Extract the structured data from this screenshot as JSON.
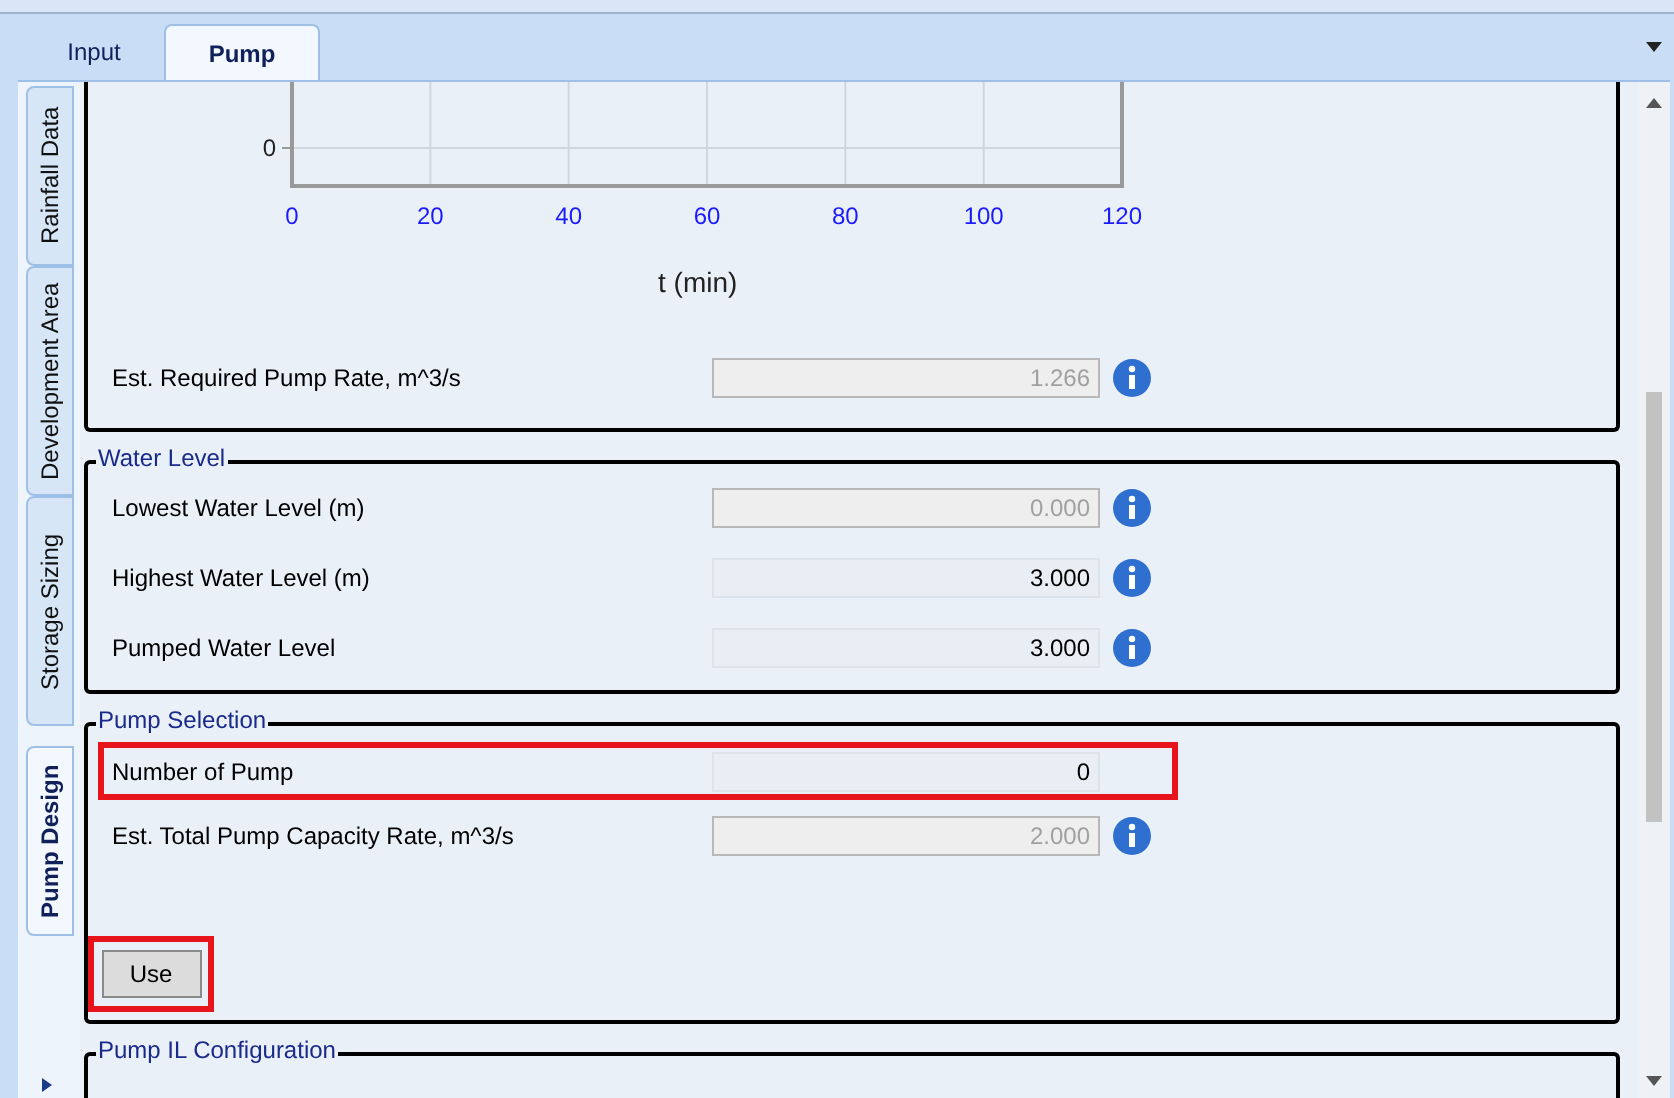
{
  "tabs": [
    {
      "label": "Input",
      "selected": false
    },
    {
      "label": "Pump",
      "selected": true
    }
  ],
  "side_tabs": [
    {
      "label": "Rainfall Data",
      "selected": false
    },
    {
      "label": "Development Area",
      "selected": false
    },
    {
      "label": "Storage Sizing",
      "selected": false
    },
    {
      "label": "Pump Design",
      "selected": true
    }
  ],
  "chart_section": {
    "plot": {
      "x_tick_labels": [
        "0",
        "20",
        "40",
        "60",
        "80",
        "100",
        "120"
      ],
      "y_tick_label": "0",
      "x_axis_title": "t (min)"
    },
    "fields": [
      {
        "label": "Est. Required Pump Rate, m^3/s",
        "value": "1.266",
        "disabled": true,
        "info": true,
        "highlighted": false
      }
    ]
  },
  "water_level": {
    "title": "Water Level",
    "fields": [
      {
        "label": "Lowest Water Level (m)",
        "value": "0.000",
        "disabled": true,
        "info": true,
        "highlighted": false
      },
      {
        "label": "Highest Water Level (m)",
        "value": "3.000",
        "disabled": false,
        "info": true,
        "highlighted": false
      },
      {
        "label": "Pumped Water Level",
        "value": "3.000",
        "disabled": false,
        "info": true,
        "highlighted": false
      }
    ]
  },
  "pump_selection": {
    "title": "Pump Selection",
    "fields": [
      {
        "label": "Number of Pump",
        "value": "0",
        "disabled": false,
        "info": false,
        "highlighted": true
      },
      {
        "label": "Est. Total Pump Capacity Rate, m^3/s",
        "value": "2.000",
        "disabled": true,
        "info": true,
        "highlighted": false
      }
    ],
    "button": {
      "label": "Use",
      "highlighted": true
    }
  },
  "pump_il": {
    "title": "Pump IL Configuration"
  }
}
